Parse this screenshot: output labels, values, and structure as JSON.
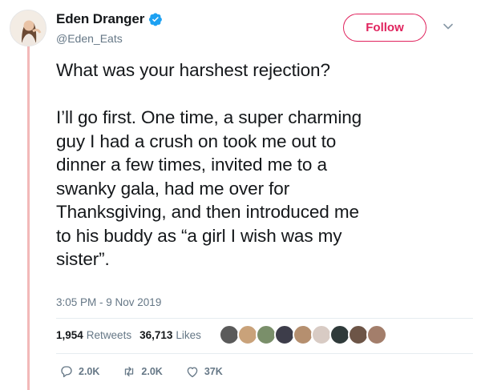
{
  "author": {
    "display_name": "Eden Dranger",
    "handle": "@Eden_Eats",
    "verified": true
  },
  "follow_label": "Follow",
  "tweet": {
    "lines": [
      "What was your harshest rejection?",
      "",
      "I’ll go first. One time, a super charming",
      "guy I had a crush on took me out to",
      "dinner a few times, invited me to a",
      "swanky gala, had me over for",
      "Thanksgiving, and then introduced me",
      "to his buddy as “a girl I wish was my",
      "sister”."
    ],
    "timestamp": "3:05 PM - 9 Nov 2019"
  },
  "stats": {
    "retweets_count": "1,954",
    "retweets_label": "Retweets",
    "likes_count": "36,713",
    "likes_label": "Likes"
  },
  "actions": {
    "reply_count": "2.0K",
    "retweet_count": "2.0K",
    "like_count": "37K"
  },
  "colors": {
    "accent": "#e0245e",
    "verified_blue": "#1da1f2",
    "muted_text": "#657786",
    "thread_line": "#f2b8b8"
  },
  "icons": [
    "verified-badge-icon",
    "chevron-down-icon",
    "reply-icon",
    "retweet-icon",
    "like-heart-icon"
  ]
}
